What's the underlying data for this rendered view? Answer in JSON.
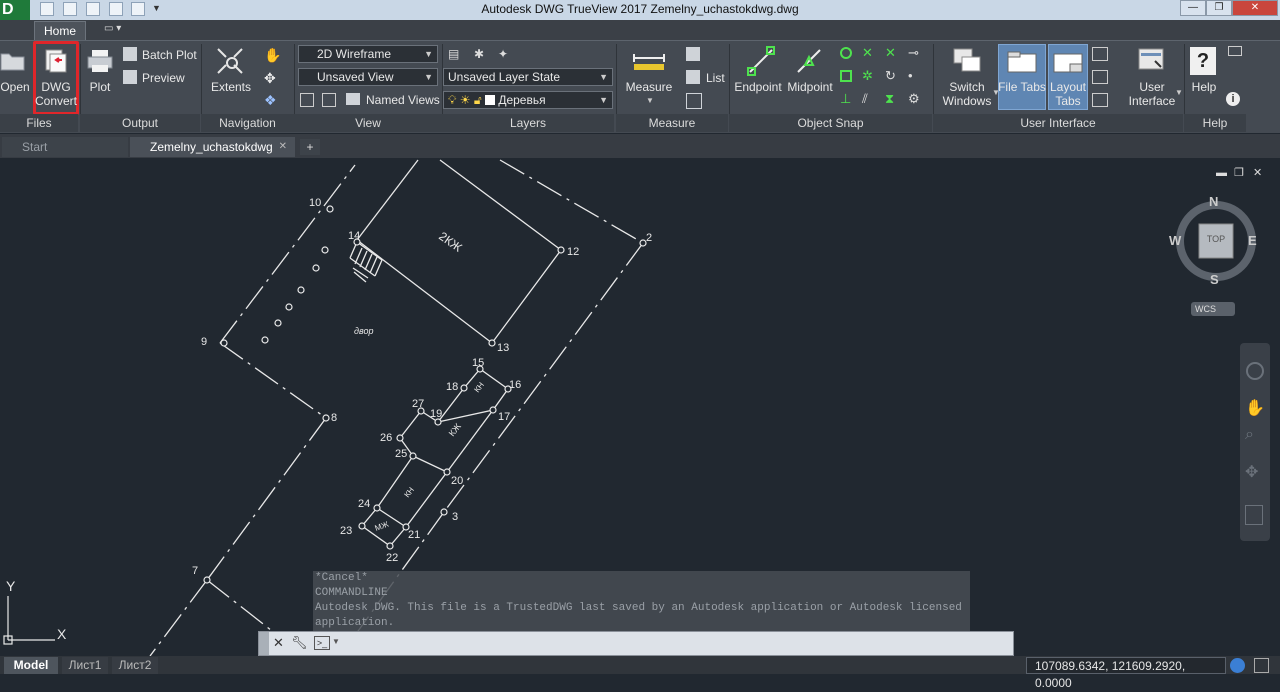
{
  "window": {
    "title": "Autodesk DWG TrueView 2017   Zemelny_uchastokdwg.dwg"
  },
  "ribbon_tabs": {
    "home": "Home"
  },
  "files": {
    "open": "Open",
    "dwg_convert_1": "DWG",
    "dwg_convert_2": "Convert",
    "panel": "Files"
  },
  "output": {
    "plot": "Plot",
    "batch_plot": "Batch Plot",
    "preview": "Preview",
    "panel": "Output"
  },
  "navigation": {
    "extents": "Extents",
    "panel": "Navigation"
  },
  "view": {
    "visual_style": "2D Wireframe",
    "named_view": "Unsaved View",
    "named_views": "Named Views",
    "panel": "View"
  },
  "layers": {
    "layer_state": "Unsaved Layer State",
    "current_layer": "Деревья",
    "panel": "Layers"
  },
  "measure": {
    "measure": "Measure",
    "list": "List",
    "panel": "Measure"
  },
  "osnap": {
    "endpoint": "Endpoint",
    "midpoint": "Midpoint",
    "panel": "Object Snap"
  },
  "ui": {
    "switch_1": "Switch",
    "switch_2": "Windows",
    "file_tabs": "File Tabs",
    "layout_1": "Layout",
    "layout_2": "Tabs",
    "user_1": "User",
    "user_2": "Interface",
    "panel": "User Interface"
  },
  "help": {
    "help": "Help",
    "panel": "Help"
  },
  "file_tabs": {
    "start": "Start",
    "current": "Zemelny_uchastokdwg"
  },
  "viewcube": {
    "n": "N",
    "s": "S",
    "e": "E",
    "w": "W",
    "face": "TOP",
    "wcs": "WCS"
  },
  "ucs": {
    "y": "Y",
    "x": "X"
  },
  "drawing_labels": {
    "p2": "2",
    "p3": "3",
    "p7": "7",
    "p8": "8",
    "p9": "9",
    "p10": "10",
    "p12": "12",
    "p13": "13",
    "p14": "14",
    "p15": "15",
    "p16": "16",
    "p17": "17",
    "p18": "18",
    "p19": "19",
    "p20": "20",
    "p21": "21",
    "p22": "22",
    "p23": "23",
    "p24": "24",
    "p25": "25",
    "p26": "26",
    "p27": "27",
    "house": "2КЖ",
    "yard": "двор",
    "kn": "КН",
    "kzh": "КЖ",
    "kn2": "КН",
    "mzh": "МЖ"
  },
  "command": {
    "history": [
      "*Cancel*",
      "COMMANDLINE",
      "Autodesk DWG.  This file is a TrustedDWG last saved by an Autodesk application or Autodesk licensed",
      "application."
    ],
    "prompt": ""
  },
  "layout_tabs": {
    "model": "Model",
    "layout1": "Лист1",
    "layout2": "Лист2"
  },
  "status": {
    "coords": "107089.6342, 121609.2920, 0.0000"
  },
  "colors": {
    "background": "#212830",
    "ribbon": "#444a52",
    "highlight_red": "#e0262a",
    "active_blue": "#5f86b3"
  }
}
